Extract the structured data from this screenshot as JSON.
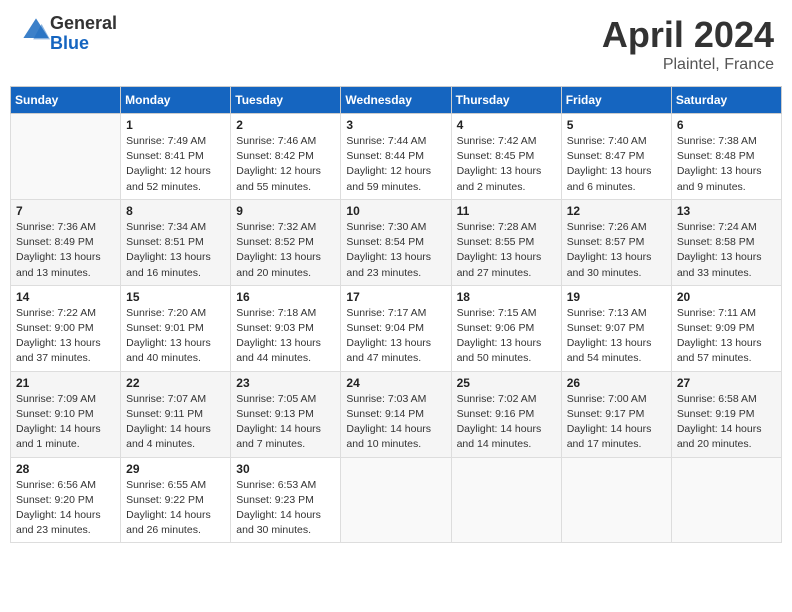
{
  "header": {
    "logo_general": "General",
    "logo_blue": "Blue",
    "month_title": "April 2024",
    "location": "Plaintel, France"
  },
  "days_of_week": [
    "Sunday",
    "Monday",
    "Tuesday",
    "Wednesday",
    "Thursday",
    "Friday",
    "Saturday"
  ],
  "weeks": [
    [
      {
        "day": "",
        "info": ""
      },
      {
        "day": "1",
        "info": "Sunrise: 7:49 AM\nSunset: 8:41 PM\nDaylight: 12 hours\nand 52 minutes."
      },
      {
        "day": "2",
        "info": "Sunrise: 7:46 AM\nSunset: 8:42 PM\nDaylight: 12 hours\nand 55 minutes."
      },
      {
        "day": "3",
        "info": "Sunrise: 7:44 AM\nSunset: 8:44 PM\nDaylight: 12 hours\nand 59 minutes."
      },
      {
        "day": "4",
        "info": "Sunrise: 7:42 AM\nSunset: 8:45 PM\nDaylight: 13 hours\nand 2 minutes."
      },
      {
        "day": "5",
        "info": "Sunrise: 7:40 AM\nSunset: 8:47 PM\nDaylight: 13 hours\nand 6 minutes."
      },
      {
        "day": "6",
        "info": "Sunrise: 7:38 AM\nSunset: 8:48 PM\nDaylight: 13 hours\nand 9 minutes."
      }
    ],
    [
      {
        "day": "7",
        "info": "Sunrise: 7:36 AM\nSunset: 8:49 PM\nDaylight: 13 hours\nand 13 minutes."
      },
      {
        "day": "8",
        "info": "Sunrise: 7:34 AM\nSunset: 8:51 PM\nDaylight: 13 hours\nand 16 minutes."
      },
      {
        "day": "9",
        "info": "Sunrise: 7:32 AM\nSunset: 8:52 PM\nDaylight: 13 hours\nand 20 minutes."
      },
      {
        "day": "10",
        "info": "Sunrise: 7:30 AM\nSunset: 8:54 PM\nDaylight: 13 hours\nand 23 minutes."
      },
      {
        "day": "11",
        "info": "Sunrise: 7:28 AM\nSunset: 8:55 PM\nDaylight: 13 hours\nand 27 minutes."
      },
      {
        "day": "12",
        "info": "Sunrise: 7:26 AM\nSunset: 8:57 PM\nDaylight: 13 hours\nand 30 minutes."
      },
      {
        "day": "13",
        "info": "Sunrise: 7:24 AM\nSunset: 8:58 PM\nDaylight: 13 hours\nand 33 minutes."
      }
    ],
    [
      {
        "day": "14",
        "info": "Sunrise: 7:22 AM\nSunset: 9:00 PM\nDaylight: 13 hours\nand 37 minutes."
      },
      {
        "day": "15",
        "info": "Sunrise: 7:20 AM\nSunset: 9:01 PM\nDaylight: 13 hours\nand 40 minutes."
      },
      {
        "day": "16",
        "info": "Sunrise: 7:18 AM\nSunset: 9:03 PM\nDaylight: 13 hours\nand 44 minutes."
      },
      {
        "day": "17",
        "info": "Sunrise: 7:17 AM\nSunset: 9:04 PM\nDaylight: 13 hours\nand 47 minutes."
      },
      {
        "day": "18",
        "info": "Sunrise: 7:15 AM\nSunset: 9:06 PM\nDaylight: 13 hours\nand 50 minutes."
      },
      {
        "day": "19",
        "info": "Sunrise: 7:13 AM\nSunset: 9:07 PM\nDaylight: 13 hours\nand 54 minutes."
      },
      {
        "day": "20",
        "info": "Sunrise: 7:11 AM\nSunset: 9:09 PM\nDaylight: 13 hours\nand 57 minutes."
      }
    ],
    [
      {
        "day": "21",
        "info": "Sunrise: 7:09 AM\nSunset: 9:10 PM\nDaylight: 14 hours\nand 1 minute."
      },
      {
        "day": "22",
        "info": "Sunrise: 7:07 AM\nSunset: 9:11 PM\nDaylight: 14 hours\nand 4 minutes."
      },
      {
        "day": "23",
        "info": "Sunrise: 7:05 AM\nSunset: 9:13 PM\nDaylight: 14 hours\nand 7 minutes."
      },
      {
        "day": "24",
        "info": "Sunrise: 7:03 AM\nSunset: 9:14 PM\nDaylight: 14 hours\nand 10 minutes."
      },
      {
        "day": "25",
        "info": "Sunrise: 7:02 AM\nSunset: 9:16 PM\nDaylight: 14 hours\nand 14 minutes."
      },
      {
        "day": "26",
        "info": "Sunrise: 7:00 AM\nSunset: 9:17 PM\nDaylight: 14 hours\nand 17 minutes."
      },
      {
        "day": "27",
        "info": "Sunrise: 6:58 AM\nSunset: 9:19 PM\nDaylight: 14 hours\nand 20 minutes."
      }
    ],
    [
      {
        "day": "28",
        "info": "Sunrise: 6:56 AM\nSunset: 9:20 PM\nDaylight: 14 hours\nand 23 minutes."
      },
      {
        "day": "29",
        "info": "Sunrise: 6:55 AM\nSunset: 9:22 PM\nDaylight: 14 hours\nand 26 minutes."
      },
      {
        "day": "30",
        "info": "Sunrise: 6:53 AM\nSunset: 9:23 PM\nDaylight: 14 hours\nand 30 minutes."
      },
      {
        "day": "",
        "info": ""
      },
      {
        "day": "",
        "info": ""
      },
      {
        "day": "",
        "info": ""
      },
      {
        "day": "",
        "info": ""
      }
    ]
  ]
}
